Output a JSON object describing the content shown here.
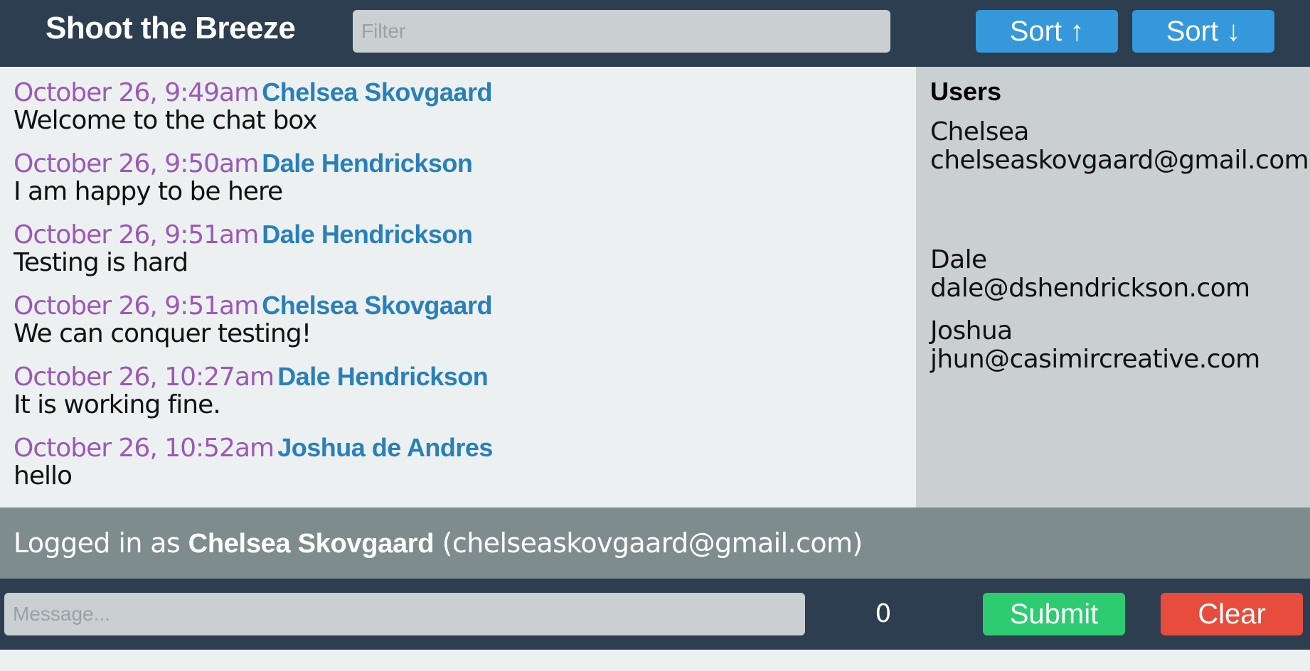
{
  "header": {
    "title": "Shoot the Breeze",
    "filter_placeholder": "Filter",
    "sort_up_label": "Sort ↑",
    "sort_down_label": "Sort ↓"
  },
  "messages": [
    {
      "time": "October 26, 9:49am",
      "user": "Chelsea Skovgaard",
      "text": "Welcome to the chat box"
    },
    {
      "time": "October 26, 9:50am",
      "user": "Dale Hendrickson",
      "text": "I am happy to be here"
    },
    {
      "time": "October 26, 9:51am",
      "user": "Dale Hendrickson",
      "text": "Testing is hard"
    },
    {
      "time": "October 26, 9:51am",
      "user": "Chelsea Skovgaard",
      "text": "We can conquer testing!"
    },
    {
      "time": "October 26, 10:27am",
      "user": "Dale Hendrickson",
      "text": "It is working fine."
    },
    {
      "time": "October 26, 10:52am",
      "user": "Joshua de Andres",
      "text": "hello"
    }
  ],
  "users_panel": {
    "title": "Users",
    "users": [
      {
        "name": "Chelsea",
        "email": "chelseaskovgaard@gmail.com"
      },
      {
        "name": "Dale",
        "email": "dale@dshendrickson.com"
      },
      {
        "name": "Joshua",
        "email": "jhun@casimircreative.com"
      }
    ]
  },
  "status": {
    "prefix": "Logged in as",
    "name": "Chelsea Skovgaard",
    "email": "(chelseaskovgaard@gmail.com)"
  },
  "composer": {
    "placeholder": "Message...",
    "char_count": "0",
    "submit_label": "Submit",
    "clear_label": "Clear"
  },
  "colors": {
    "header_bg": "#2c3e50",
    "accent_blue": "#3498db",
    "timestamp": "#9b59b6",
    "username": "#2980b9",
    "submit": "#2ecc71",
    "clear": "#e74c3c",
    "status_bar": "#7f8c8d"
  }
}
